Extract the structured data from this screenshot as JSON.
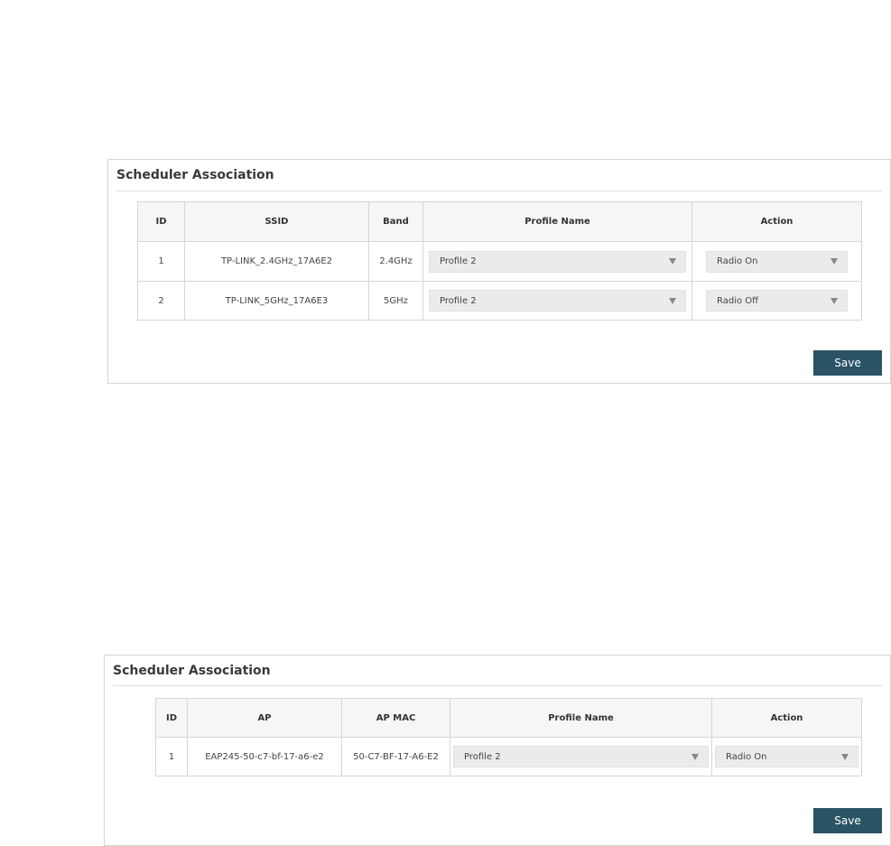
{
  "ssid_panel": {
    "title": "Scheduler Association",
    "headers": {
      "id": "ID",
      "ssid": "SSID",
      "band": "Band",
      "profile": "Profile Name",
      "action": "Action"
    },
    "rows": [
      {
        "id": "1",
        "ssid": "TP-LINK_2.4GHz_17A6E2",
        "band": "2.4GHz",
        "profile": "Profile 2",
        "action": "Radio On"
      },
      {
        "id": "2",
        "ssid": "TP-LINK_5GHz_17A6E3",
        "band": "5GHz",
        "profile": "Profile 2",
        "action": "Radio Off"
      }
    ],
    "save_label": "Save"
  },
  "ap_panel": {
    "title": "Scheduler Association",
    "headers": {
      "id": "ID",
      "ap": "AP",
      "ap_mac": "AP MAC",
      "profile": "Profile Name",
      "action": "Action"
    },
    "rows": [
      {
        "id": "1",
        "ap": "EAP245-50-c7-bf-17-a6-e2",
        "ap_mac": "50-C7-BF-17-A6-E2",
        "profile": "Profile 2",
        "action": "Radio On"
      }
    ],
    "save_label": "Save"
  },
  "icons": {
    "dropdown": "chevron-down-icon"
  },
  "colors": {
    "save_button": "#2a5466",
    "header_bg": "#f6f6f6",
    "select_bg": "#ebebeb"
  }
}
